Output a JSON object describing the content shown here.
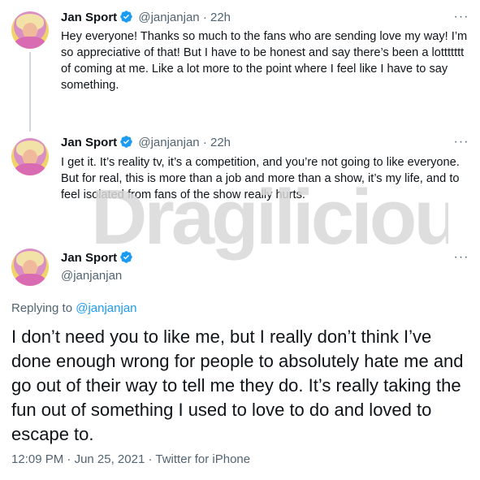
{
  "tweets": [
    {
      "name": "Jan Sport",
      "handle": "@janjanjan",
      "sep": "·",
      "time": "22h",
      "more": "···",
      "text": "Hey everyone! Thanks so much to the fans who are sending love my way! I’m so appreciative of that! But I have to be honest and say there’s been a lottttttt of coming at me. Like a lot more to the point where I feel like I have to say something."
    },
    {
      "name": "Jan Sport",
      "handle": "@janjanjan",
      "sep": "·",
      "time": "22h",
      "more": "···",
      "text": "I get it. It’s reality tv, it’s a competition, and you’re not going to like everyone. But for real, this is more than a job and more than a show, it’s my life, and to feel isolated from fans of the show really hurts."
    }
  ],
  "focused": {
    "name": "Jan Sport",
    "handle": "@janjanjan",
    "more": "···",
    "replying_prefix": "Replying to",
    "replying_handle": "@janjanjan",
    "text": "I don’t need you to like me, but I really don’t think I’ve done enough wrong for people to absolutely hate me and go out of their way to tell me they do. It’s really taking the fun out of something I used to love to do and loved to escape to.",
    "time": "12:09 PM",
    "sep": "·",
    "date": "Jun 25, 2021",
    "source": "Twitter for iPhone"
  },
  "watermark": {
    "text": "Dragilicious",
    "color": "#d9d9d9"
  },
  "colors": {
    "accent": "#1d9bf0",
    "text": "#0f1419",
    "muted": "#536471",
    "line": "#cfd9de"
  }
}
